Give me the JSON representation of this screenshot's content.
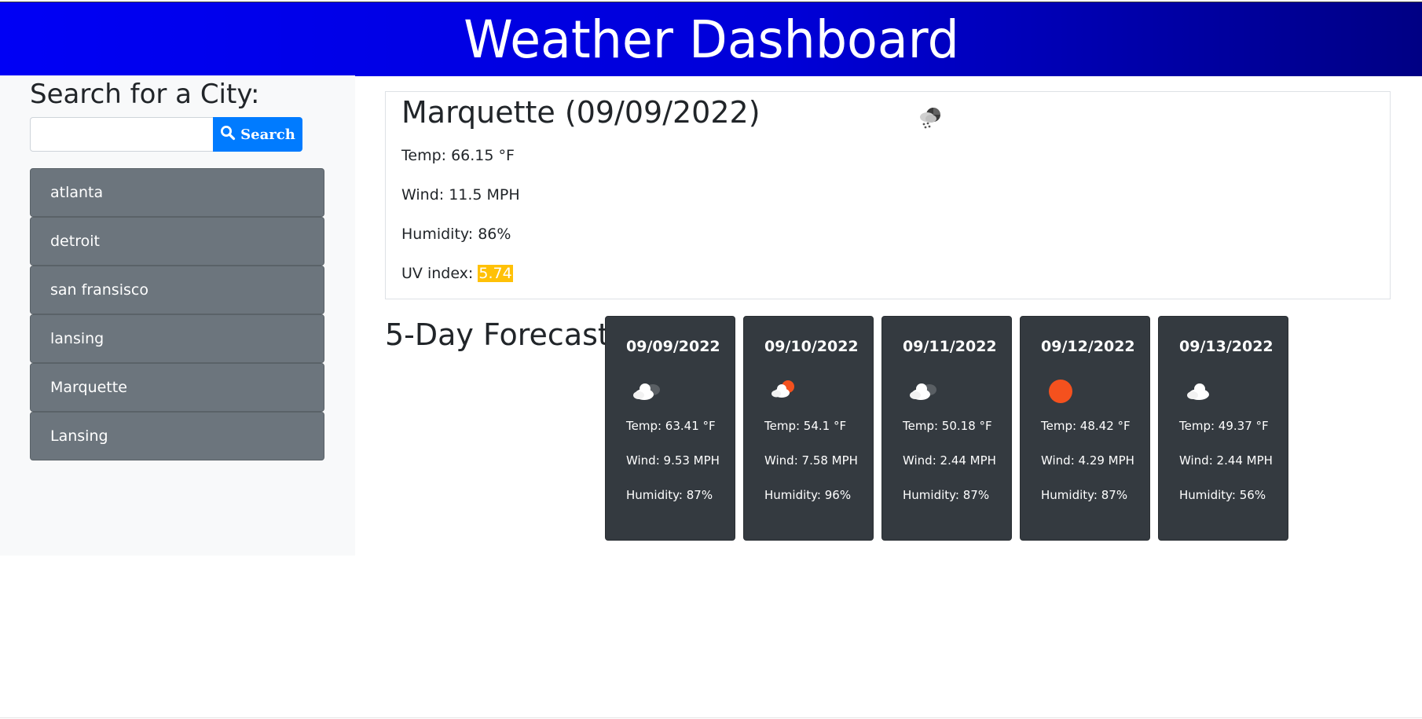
{
  "header": {
    "title": "Weather Dashboard"
  },
  "sidebar": {
    "search_label": "Search for a City:",
    "search_placeholder": "",
    "search_value": "",
    "search_button_label": "Search",
    "history": [
      "atlanta",
      "detroit",
      "san fransisco",
      "lansing",
      "Marquette",
      "Lansing"
    ]
  },
  "current": {
    "title": "Marquette (09/09/2022)",
    "icon": "cloud-rain-sun-icon",
    "temp": "Temp: 66.15 °F",
    "wind": "Wind: 11.5 MPH",
    "humidity": "Humidity: 86%",
    "uv_label": "UV index: ",
    "uv_value": "5.74",
    "uv_color": "#ffc107"
  },
  "forecast": {
    "title": "5-Day Forecast:",
    "days": [
      {
        "date": "09/09/2022",
        "icon": "broken-clouds-icon",
        "temp": "Temp: 63.41 °F",
        "wind": "Wind: 9.53 MPH",
        "humidity": "Humidity: 87%"
      },
      {
        "date": "09/10/2022",
        "icon": "partly-cloudy-sun-icon",
        "temp": "Temp: 54.1 °F",
        "wind": "Wind: 7.58 MPH",
        "humidity": "Humidity: 96%"
      },
      {
        "date": "09/11/2022",
        "icon": "broken-clouds-icon",
        "temp": "Temp: 50.18 °F",
        "wind": "Wind: 2.44 MPH",
        "humidity": "Humidity: 87%"
      },
      {
        "date": "09/12/2022",
        "icon": "sun-icon",
        "temp": "Temp: 48.42 °F",
        "wind": "Wind: 4.29 MPH",
        "humidity": "Humidity: 87%"
      },
      {
        "date": "09/13/2022",
        "icon": "cloud-icon",
        "temp": "Temp: 49.37 °F",
        "wind": "Wind: 2.44 MPH",
        "humidity": "Humidity: 56%"
      }
    ]
  },
  "colors": {
    "header_start": "#0000f5",
    "header_end": "#000084",
    "search_button": "#007bff",
    "history_button": "#6c757d",
    "forecast_card": "#343a40",
    "sun": "#f4511e"
  }
}
